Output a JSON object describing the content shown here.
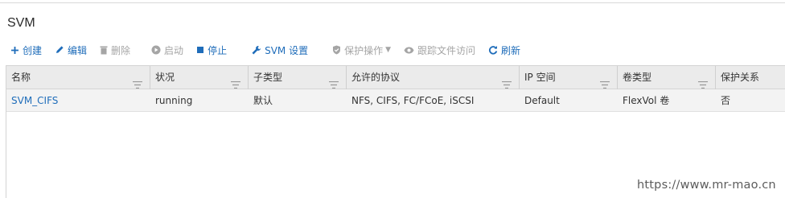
{
  "page": {
    "title": "SVM"
  },
  "toolbar": {
    "create": "创建",
    "edit": "编辑",
    "delete": "删除",
    "start": "启动",
    "stop": "停止",
    "svm_settings": "SVM 设置",
    "protect": "保护操作",
    "audit": "跟踪文件访问",
    "refresh": "刷新"
  },
  "table": {
    "columns": [
      "名称",
      "状况",
      "子类型",
      "允许的协议",
      "IP 空间",
      "卷类型",
      "保护关系"
    ],
    "rows": [
      [
        "SVM_CIFS",
        "running",
        "默认",
        "NFS, CIFS, FC/FCoE, iSCSI",
        "Default",
        "FlexVol 卷",
        "否"
      ]
    ]
  },
  "watermark": "https://www.mr-mao.cn",
  "colors": {
    "accent": "#1f6dba",
    "disabled": "#a5a5a5",
    "header_bg": "#ebebeb",
    "row_bg": "#f3f3f3"
  },
  "icons": {
    "create": "plus-icon",
    "edit": "pencil-icon",
    "delete": "trash-icon",
    "start": "play-icon",
    "stop": "stop-icon",
    "svm_settings": "wrench-icon",
    "protect": "shield-icon",
    "audit": "eye-icon",
    "refresh": "refresh-icon",
    "column_filter": "filter-icon"
  }
}
